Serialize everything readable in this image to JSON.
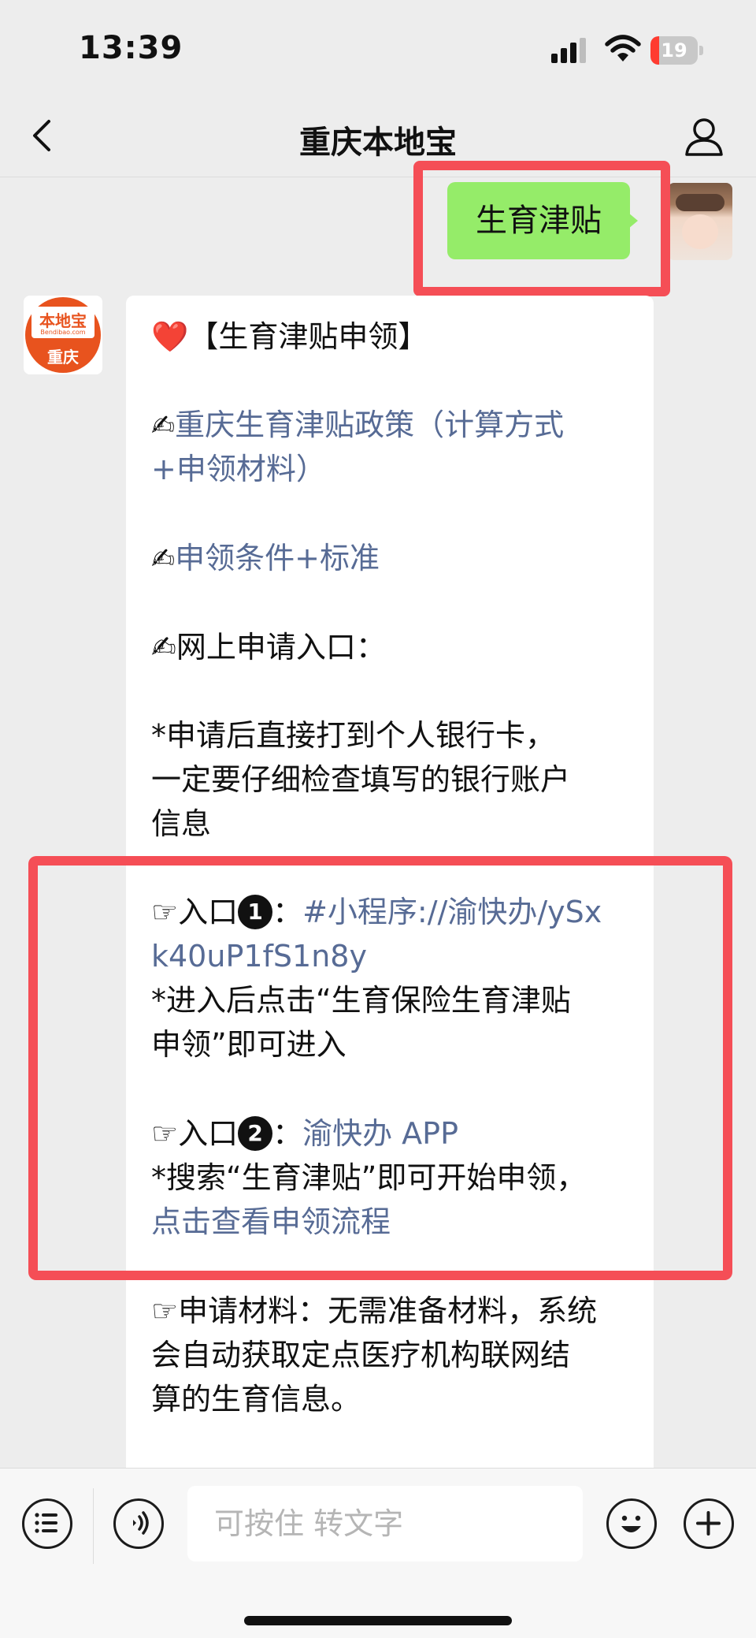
{
  "status": {
    "time": "13:39",
    "battery_level": "19",
    "battery_fraction": 0.19
  },
  "nav": {
    "title": "重庆本地宝"
  },
  "user_message": {
    "text": "生育津贴"
  },
  "bot_avatar": {
    "logo_text": "本地宝",
    "logo_sub": "Bendibao.com",
    "city": "重庆"
  },
  "bot_message": {
    "heading": "❤️【生育津贴申领】",
    "policy_emoji": "✍",
    "policy_link_1": "重庆生育津贴政策（计算方式",
    "policy_link_2": "+申领材料）",
    "conditions_emoji": "✍",
    "conditions_link": "申领条件+标准",
    "online_label": "✍网上申请入口：",
    "note_1": "*申请后直接打到个人银行卡，",
    "note_2": "一定要仔细检查填写的银行账户",
    "note_3": "信息",
    "entry1_prefix": "☞入口",
    "entry1_num": "1",
    "entry1_colon": "：",
    "entry1_link_1": "#小程序://渝快办/ySx",
    "entry1_link_2": "k40uP1fS1n8y",
    "entry1_note_1": "*进入后点击“生育保险生育津贴",
    "entry1_note_2": "申领”即可进入",
    "entry2_prefix": "☞入口",
    "entry2_num": "2",
    "entry2_colon": "：",
    "entry2_link": "渝快办 APP",
    "entry2_note": "*搜索“生育津贴”即可开始申领，",
    "entry2_link_flow": "点击查看申领流程",
    "materials_1": "☞申请材料：无需准备材料，系统",
    "materials_2": "会自动获取定点医疗机构联网结",
    "materials_3": "算的生育信息。"
  },
  "input_bar": {
    "placeholder": "可按住 转文字"
  },
  "icons": {
    "back": "chevron-left-icon",
    "profile": "person-icon",
    "menu": "list-icon",
    "voice": "voice-icon",
    "emoji": "smiley-icon",
    "plus": "plus-icon"
  },
  "colors": {
    "user_bubble": "#95ec69",
    "link": "#576b95",
    "highlight": "#f54e56",
    "battery_low": "#ff3b30"
  }
}
